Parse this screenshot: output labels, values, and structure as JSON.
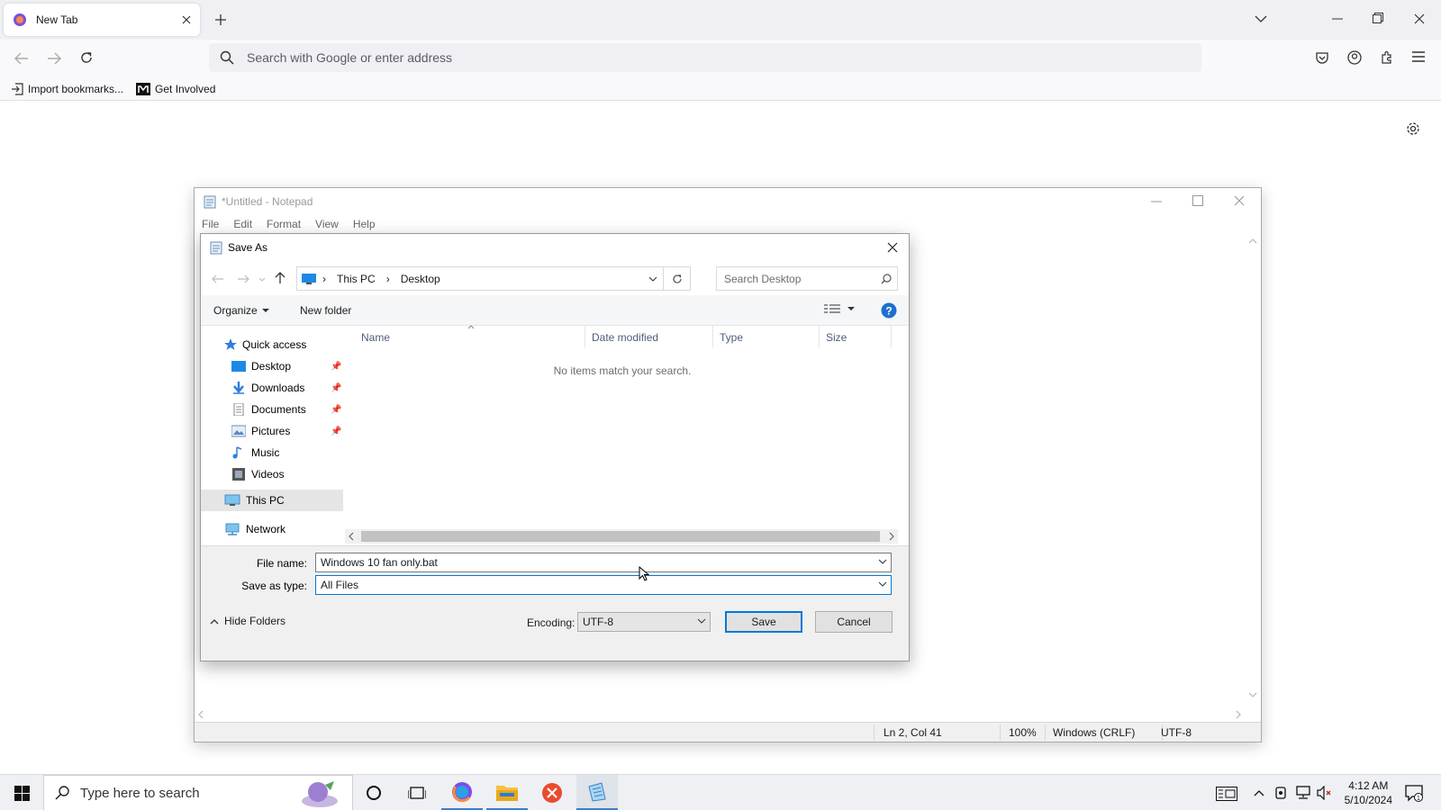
{
  "browser": {
    "tab_title": "New Tab",
    "url_placeholder": "Search with Google or enter address",
    "bookmarks": [
      "Import bookmarks...",
      "Get Involved"
    ]
  },
  "notepad": {
    "title": "*Untitled - Notepad",
    "menu": [
      "File",
      "Edit",
      "Format",
      "View",
      "Help"
    ],
    "status": {
      "position": "Ln 2, Col 41",
      "zoom": "100%",
      "line_ending": "Windows (CRLF)",
      "encoding": "UTF-8"
    }
  },
  "dialog": {
    "title": "Save As",
    "breadcrumb": [
      "This PC",
      "Desktop"
    ],
    "search_placeholder": "Search Desktop",
    "organize": "Organize",
    "new_folder": "New folder",
    "nav": {
      "quick_access": "Quick access",
      "desktop": "Desktop",
      "downloads": "Downloads",
      "documents": "Documents",
      "pictures": "Pictures",
      "music": "Music",
      "videos": "Videos",
      "this_pc": "This PC",
      "network": "Network"
    },
    "columns": [
      "Name",
      "Date modified",
      "Type",
      "Size"
    ],
    "empty_message": "No items match your search.",
    "file_name_label": "File name:",
    "file_name_value": "Windows 10 fan only.bat",
    "save_type_label": "Save as type:",
    "save_type_value": "All Files",
    "hide_folders": "Hide Folders",
    "encoding_label": "Encoding:",
    "encoding_value": "UTF-8",
    "save": "Save",
    "cancel": "Cancel"
  },
  "taskbar": {
    "search_placeholder": "Type here to search",
    "time": "4:12 AM",
    "date": "5/10/2024"
  },
  "colors": {
    "accent": "#0078d7",
    "selection": "#e5e5e5"
  }
}
